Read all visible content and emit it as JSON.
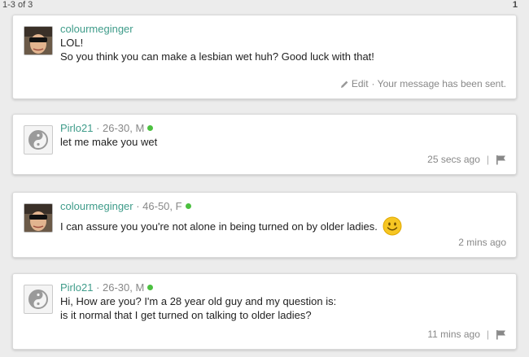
{
  "pagination": {
    "range": "1-3 of 3",
    "page": "1"
  },
  "messages": [
    {
      "username": "colourmeginger",
      "meta_suffix": "",
      "online": false,
      "lines": [
        "LOL!",
        "So you think you can make a lesbian wet huh? Good luck with that!"
      ],
      "edit_label": "Edit",
      "status": "· Your message has been sent.",
      "avatar": "photo"
    },
    {
      "username": "Pirlo21",
      "meta_suffix": " · 26-30, M",
      "online": true,
      "lines": [
        "let me make you wet"
      ],
      "time": "25 secs ago",
      "avatar": "default"
    },
    {
      "username": "colourmeginger",
      "meta_suffix": " · 46-50, F",
      "online": true,
      "lines": [
        "I can assure you you're not alone in being turned on by older ladies."
      ],
      "emoji": "smiley-face-icon",
      "time": "2 mins ago",
      "avatar": "photo"
    },
    {
      "username": "Pirlo21",
      "meta_suffix": " · 26-30, M",
      "online": true,
      "lines": [
        "Hi, How are you? I'm a 28 year old guy and my question is:",
        "is it normal that I get turned on talking to older ladies?"
      ],
      "time": "11 mins ago",
      "avatar": "default"
    }
  ],
  "colors": {
    "username": "#3f9c8a",
    "online": "#4cc040",
    "background": "#ececec"
  }
}
